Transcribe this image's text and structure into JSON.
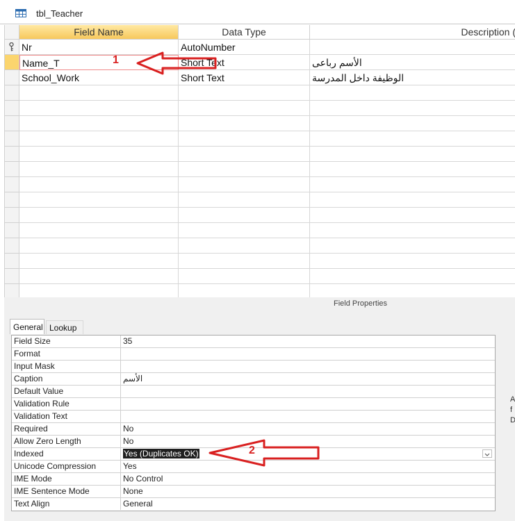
{
  "window": {
    "tab_title": "tbl_Teacher"
  },
  "grid": {
    "headers": {
      "field_name": "Field Name",
      "data_type": "Data Type",
      "description": "Description ("
    },
    "rows": [
      {
        "name": "Nr",
        "type": "AutoNumber",
        "description": "",
        "primary_key": true
      },
      {
        "name": "Name_T",
        "type": "Short Text",
        "description": "الأسم رباعى",
        "current": true
      },
      {
        "name": "School_Work",
        "type": "Short Text",
        "description": "الوظيفة داخل المدرسة"
      }
    ]
  },
  "field_properties": {
    "title": "Field Properties",
    "tabs": {
      "general": "General",
      "lookup": "Lookup"
    },
    "rows": [
      {
        "label": "Field Size",
        "value": "35"
      },
      {
        "label": "Format",
        "value": ""
      },
      {
        "label": "Input Mask",
        "value": ""
      },
      {
        "label": "Caption",
        "value": "الأسم"
      },
      {
        "label": "Default Value",
        "value": ""
      },
      {
        "label": "Validation Rule",
        "value": ""
      },
      {
        "label": "Validation Text",
        "value": ""
      },
      {
        "label": "Required",
        "value": "No"
      },
      {
        "label": "Allow Zero Length",
        "value": "No"
      },
      {
        "label": "Indexed",
        "value": "Yes (Duplicates OK)"
      },
      {
        "label": "Unicode Compression",
        "value": "Yes"
      },
      {
        "label": "IME Mode",
        "value": "No Control"
      },
      {
        "label": "IME Sentence Mode",
        "value": "None"
      },
      {
        "label": "Text Align",
        "value": "General"
      }
    ],
    "help_fragment": [
      "A",
      "f",
      "D"
    ]
  },
  "annotations": {
    "arrow1_label": "1",
    "arrow2_label": "2"
  },
  "colors": {
    "header_accent": "#f7c85c",
    "annotation": "#d92020",
    "selection": "#1f1f1f"
  }
}
